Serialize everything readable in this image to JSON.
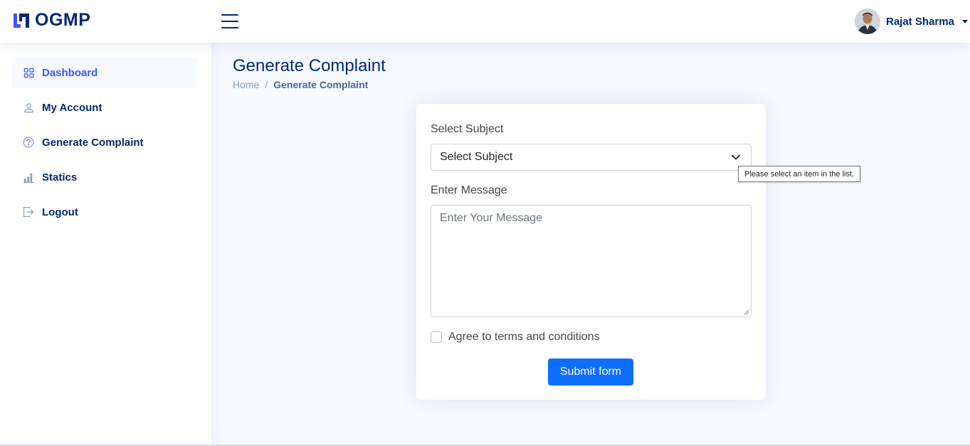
{
  "header": {
    "brand": "OGMP",
    "user_name": "Rajat Sharma"
  },
  "sidebar": {
    "items": [
      {
        "label": "Dashboard",
        "icon": "grid-icon",
        "active": true
      },
      {
        "label": "My Account",
        "icon": "person-icon",
        "active": false
      },
      {
        "label": "Generate Complaint",
        "icon": "question-circle-icon",
        "active": false
      },
      {
        "label": "Statics",
        "icon": "bar-chart-icon",
        "active": false
      },
      {
        "label": "Logout",
        "icon": "logout-icon",
        "active": false
      }
    ]
  },
  "page": {
    "title": "Generate Complaint",
    "breadcrumb": {
      "home": "Home",
      "separator": "/",
      "current": "Generate Complaint"
    }
  },
  "form": {
    "subject_label": "Select Subject",
    "subject_value": "Select Subject",
    "message_label": "Enter Message",
    "message_placeholder": "Enter Your Message",
    "agree_label": "Agree to terms and conditions",
    "agree_checked": false,
    "submit_label": "Submit form"
  },
  "tooltip": {
    "text": "Please select an item in the list."
  },
  "colors": {
    "primary": "#012970",
    "accent": "#4154f1",
    "button": "#0d6efd",
    "background": "#f6f9ff"
  }
}
